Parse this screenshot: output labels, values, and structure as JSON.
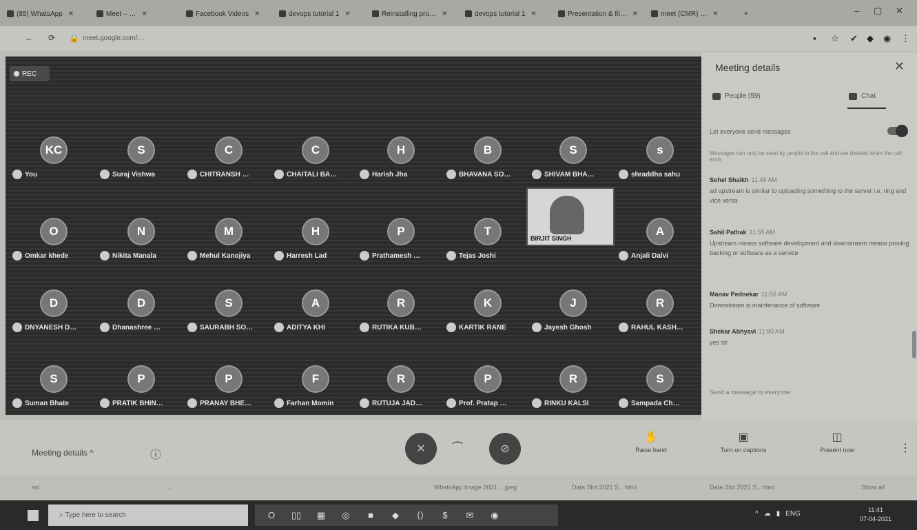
{
  "browser": {
    "tabs": [
      {
        "label": "(85) WhatsApp"
      },
      {
        "label": "Meet – …"
      },
      {
        "label": "Facebook Videos"
      },
      {
        "label": "devops tutorial 1"
      },
      {
        "label": "Reinstalling pro…"
      },
      {
        "label": "devops tutorial 1"
      },
      {
        "label": "Presentation & fil…"
      },
      {
        "label": "meet (CMR) …"
      }
    ],
    "url": "meet.google.com/…",
    "controls": {
      "minimize": "–",
      "maximize": "▢",
      "close": "✕"
    }
  },
  "meeting": {
    "rec_label": "REC",
    "participants": [
      {
        "initial": "KC",
        "name": "You"
      },
      {
        "initial": "S",
        "name": "Suraj Vishwa"
      },
      {
        "initial": "C",
        "name": "CHITRANSH …"
      },
      {
        "initial": "C",
        "name": "CHAITALI BA…"
      },
      {
        "initial": "H",
        "name": "Harish Jha"
      },
      {
        "initial": "B",
        "name": "BHAVANA SO…"
      },
      {
        "initial": "S",
        "name": "SHIVAM BHA…"
      },
      {
        "initial": "s",
        "name": "shraddha sahu"
      },
      {
        "initial": "O",
        "name": "Omkar khede"
      },
      {
        "initial": "N",
        "name": "Nikita Manala"
      },
      {
        "initial": "M",
        "name": "Mehul Kanojiya"
      },
      {
        "initial": "H",
        "name": "Harresh Lad"
      },
      {
        "initial": "P",
        "name": "Prathamesh …"
      },
      {
        "initial": "T",
        "name": "Tejas Joshi"
      },
      {
        "initial": "",
        "name": ""
      },
      {
        "initial": "A",
        "name": "Anjali Dalvi"
      },
      {
        "initial": "D",
        "name": "DNYANESH D…"
      },
      {
        "initial": "D",
        "name": "Dhanashree …"
      },
      {
        "initial": "S",
        "name": "SAURABH SO…"
      },
      {
        "initial": "A",
        "name": "ADITYA KHI"
      },
      {
        "initial": "R",
        "name": "RUTIKA KUB…"
      },
      {
        "initial": "K",
        "name": "KARTIK RANE"
      },
      {
        "initial": "J",
        "name": "Jayesh Ghosh"
      },
      {
        "initial": "R",
        "name": "RAHUL KASH…"
      },
      {
        "initial": "S",
        "name": "Suman Bhate"
      },
      {
        "initial": "P",
        "name": "PRATIK BHIN…"
      },
      {
        "initial": "P",
        "name": "PRANAY BHE…"
      },
      {
        "initial": "F",
        "name": "Farhan Momin"
      },
      {
        "initial": "R",
        "name": "RUTUJA JAD…"
      },
      {
        "initial": "P",
        "name": "Prof. Pratap …"
      },
      {
        "initial": "R",
        "name": "RINKU KALSI"
      },
      {
        "initial": "S",
        "name": "Sampada Ch…"
      }
    ],
    "video_tile_name": "BIRJIT SINGH"
  },
  "panel": {
    "title": "Meeting details",
    "close": "✕",
    "tabs": {
      "people": "People (59)",
      "chat": "Chat"
    },
    "toggle_label": "Let everyone send messages",
    "note": "Messages can only be seen by people in the call and are deleted when the call ends",
    "messages": [
      {
        "author": "Sohel Shaikh",
        "time": "11:49 AM",
        "text": "ad upstream is similar to uploading something to the server i.e. ring and vice versa"
      },
      {
        "author": "Sahil Pathak",
        "time": "11:55 AM",
        "text": "Upstream means software development and downstream means proving backing or software as a service"
      },
      {
        "author": "Manav Pednekar",
        "time": "11:56 AM",
        "text": "Downstream is maintenance of software"
      },
      {
        "author": "Shekar Abhyavi",
        "time": "11:80 AM",
        "text": "yes sir"
      }
    ],
    "send_placeholder": "Send a message to everyone"
  },
  "controls": {
    "meeting_details": "Meeting details",
    "chevron": "^",
    "mic_icon": "✕",
    "hangup": "⏜",
    "cam_icon": "⊘",
    "raise_hand": "Raise hand",
    "captions": "Turn on captions",
    "present": "Present now",
    "more": "⋮"
  },
  "downloads": [
    {
      "label": "ssl"
    },
    {
      "label": "…"
    },
    {
      "label": "WhatsApp Image 2021 …jpeg"
    },
    {
      "label": "Data Slot 2021 S…html"
    },
    {
      "label": "Data Slot 2021 S…html"
    },
    {
      "label": "Show all"
    }
  ],
  "taskbar": {
    "search_placeholder": "Type here to search",
    "apps": [
      "O",
      "▯▯",
      "▦",
      "◎",
      "■",
      "◆",
      "⟨⟩",
      "$",
      "✉",
      "◉"
    ],
    "tray": [
      "^",
      "☁",
      "▮",
      "ENG"
    ],
    "time": "11:41",
    "date": "07-04-2021"
  }
}
